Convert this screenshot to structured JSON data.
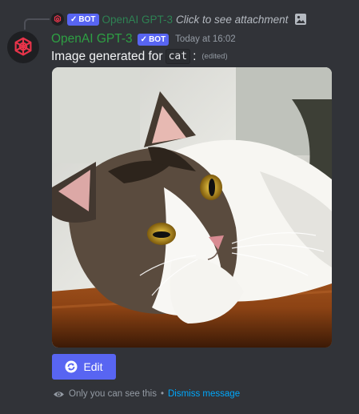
{
  "reply": {
    "bot_tag": "BOT",
    "author": "OpenAI GPT-3",
    "text": "Click to see attachment",
    "attachment_icon": "image-icon"
  },
  "message": {
    "author": "OpenAI GPT-3",
    "bot_tag": "BOT",
    "timestamp": "Today at 16:02",
    "content_prefix": "Image generated for",
    "code": "cat",
    "colon": ":",
    "edited": "(edited)",
    "avatar_icon": "openai-logo-icon",
    "attachment": {
      "type": "image",
      "subject": "cat"
    }
  },
  "actions": {
    "edit_label": "Edit",
    "edit_icon": "refresh-icon"
  },
  "ephemeral": {
    "icon": "eye-icon",
    "text": "Only you can see this",
    "separator": "•",
    "dismiss_label": "Dismiss message"
  },
  "colors": {
    "background": "#313338",
    "author": "#2ea043",
    "blurple": "#5865f2",
    "link": "#00a8fc",
    "logo": "#e8344a"
  }
}
